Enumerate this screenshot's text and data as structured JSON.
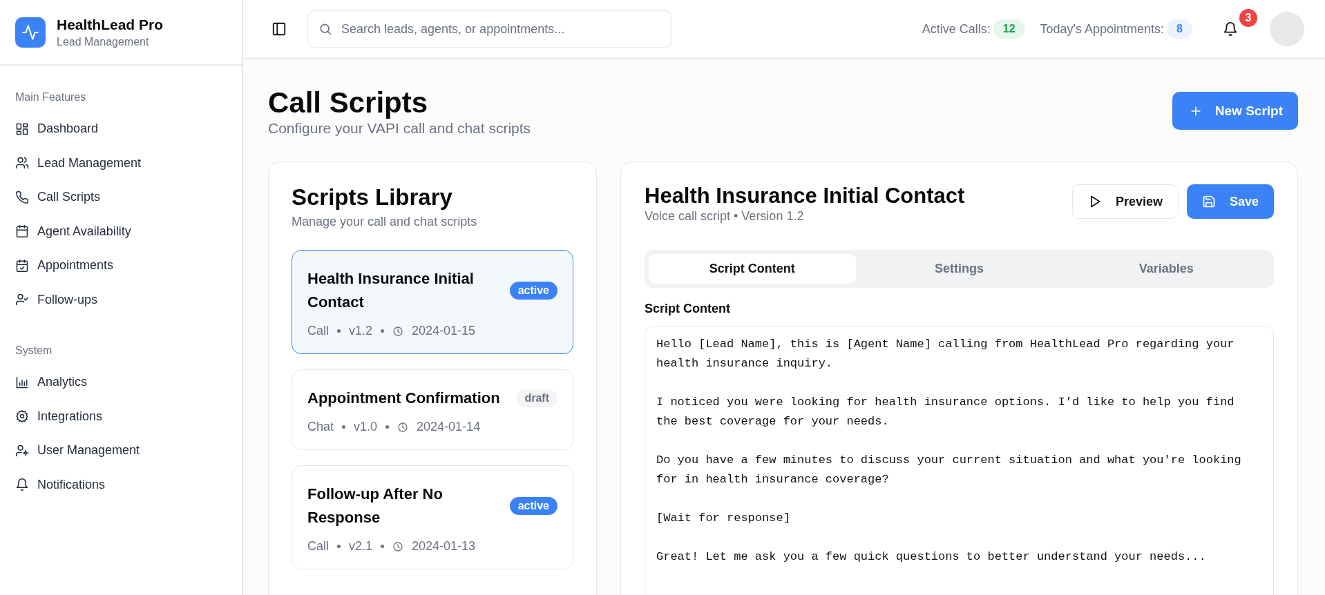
{
  "brand": {
    "name": "HealthLead Pro",
    "subtitle": "Lead Management"
  },
  "sidebar": {
    "sections": [
      {
        "title": "Main Features",
        "items": [
          {
            "label": "Dashboard",
            "selected": false
          },
          {
            "label": "Lead Management",
            "selected": false
          },
          {
            "label": "Call Scripts",
            "selected": false
          },
          {
            "label": "Agent Availability",
            "selected": false
          },
          {
            "label": "Appointments",
            "selected": false
          },
          {
            "label": "Follow-ups",
            "selected": false
          }
        ]
      },
      {
        "title": "System",
        "items": [
          {
            "label": "Analytics",
            "selected": false
          },
          {
            "label": "Integrations",
            "selected": false
          },
          {
            "label": "User Management",
            "selected": false
          },
          {
            "label": "Notifications",
            "selected": false
          }
        ]
      }
    ]
  },
  "header": {
    "search": {
      "placeholder": "Search leads, agents, or appointments..."
    },
    "stats": [
      {
        "label": "Active Calls:",
        "value": "12",
        "color": "#16a34a"
      },
      {
        "label": "Today's Appointments:",
        "value": "8",
        "color": "#3b82f6"
      }
    ],
    "notifications_count": "3"
  },
  "page": {
    "title": "Call Scripts",
    "subtitle": "Configure your VAPI call and chat scripts",
    "new_button": "New Script"
  },
  "library": {
    "title": "Scripts Library",
    "subtitle": "Manage your call and chat scripts",
    "scripts": [
      {
        "title": "Health Insurance Initial Contact",
        "status": "active",
        "type": "Call",
        "version": "v1.2",
        "date": "2024-01-15",
        "selected": true
      },
      {
        "title": "Appointment Confirmation",
        "status": "draft",
        "type": "Chat",
        "version": "v1.0",
        "date": "2024-01-14",
        "selected": false
      },
      {
        "title": "Follow-up After No Response",
        "status": "active",
        "type": "Call",
        "version": "v2.1",
        "date": "2024-01-13",
        "selected": false
      }
    ]
  },
  "editor": {
    "title": "Health Insurance Initial Contact",
    "subtitle": "Voice call script • Version 1.2",
    "buttons": [
      {
        "label": "Preview",
        "kind": "outline"
      },
      {
        "label": "Save",
        "kind": "primary"
      }
    ],
    "tabs": [
      {
        "label": "Script Content",
        "selected": true
      },
      {
        "label": "Settings",
        "selected": false
      },
      {
        "label": "Variables",
        "selected": false
      }
    ],
    "field_label": "Script Content",
    "content": "Hello [Lead Name], this is [Agent Name] calling from HealthLead Pro regarding your health insurance inquiry.\n\nI noticed you were looking for health insurance options. I'd like to help you find the best coverage for your needs.\n\nDo you have a few minutes to discuss your current situation and what you're looking for in health insurance coverage?\n\n[Wait for response]\n\nGreat! Let me ask you a few quick questions to better understand your needs..."
  }
}
